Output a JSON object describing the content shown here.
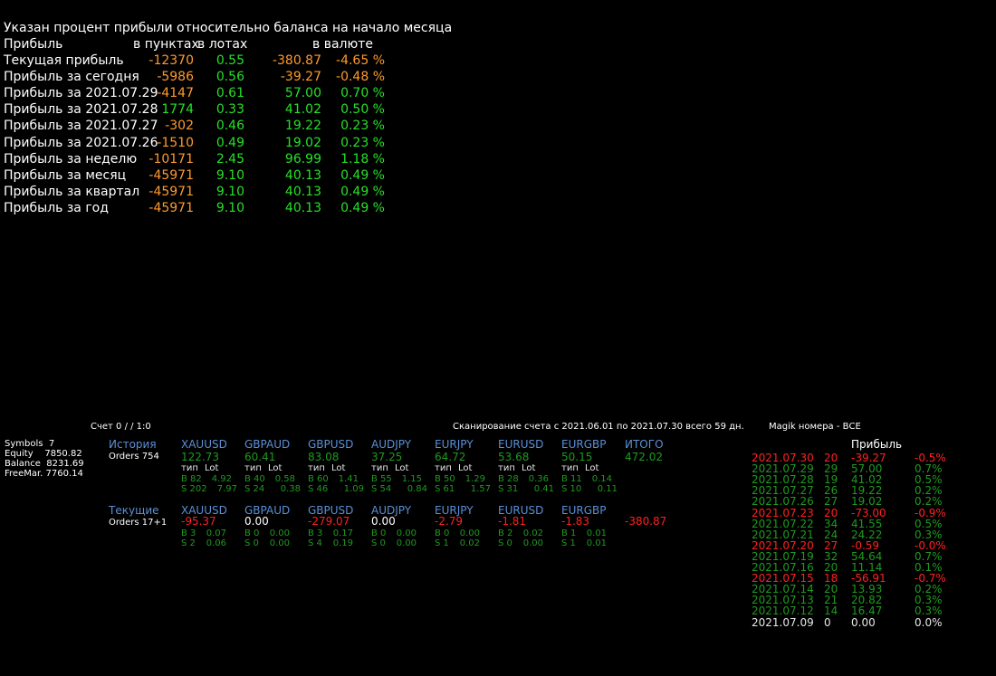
{
  "header": {
    "title": "Указан процент прибыли относительно баланса на начало месяца",
    "col_name": "Прибыль",
    "col_points": "в пунктах",
    "col_lots": "в лотах",
    "col_currency": "в валюте"
  },
  "profit_rows": [
    {
      "label": "Текущая прибыль",
      "points": "-12370",
      "lots": "0.55",
      "currency": "-380.87",
      "pct": "-4.65 %"
    },
    {
      "label": "Прибыль за сегодня",
      "points": "-5986",
      "lots": "0.56",
      "currency": "-39.27",
      "pct": "-0.48 %"
    },
    {
      "label": "Прибыль за 2021.07.29",
      "points": "-4147",
      "lots": "0.61",
      "currency": "57.00",
      "pct": "0.70 %"
    },
    {
      "label": "Прибыль за 2021.07.28",
      "points": "1774",
      "lots": "0.33",
      "currency": "41.02",
      "pct": "0.50 %"
    },
    {
      "label": "Прибыль за 2021.07.27",
      "points": "-302",
      "lots": "0.46",
      "currency": "19.22",
      "pct": "0.23 %"
    },
    {
      "label": "Прибыль за 2021.07.26",
      "points": "-1510",
      "lots": "0.49",
      "currency": "19.02",
      "pct": "0.23 %"
    },
    {
      "label": "Прибыль за неделю",
      "points": "-10171",
      "lots": "2.45",
      "currency": "96.99",
      "pct": "1.18 %"
    },
    {
      "label": "Прибыль за месяц",
      "points": "-45971",
      "lots": "9.10",
      "currency": "40.13",
      "pct": "0.49 %"
    },
    {
      "label": "Прибыль за квартал",
      "points": "-45971",
      "lots": "9.10",
      "currency": "40.13",
      "pct": "0.49 %"
    },
    {
      "label": "Прибыль за год",
      "points": "-45971",
      "lots": "9.10",
      "currency": "40.13",
      "pct": "0.49 %"
    }
  ],
  "colors": {
    "negative": "#ff9a2e",
    "positive": "#28e028",
    "loss": "#ff2020",
    "history_green": "#1f9a1f",
    "title_blue": "#5b8fd6"
  },
  "account": {
    "symbols_label": "Symbols",
    "symbols": "7",
    "equity_label": "Equity",
    "equity": "7850.82",
    "balance_label": "Balance",
    "balance": "8231.69",
    "freemar_label": "FreeMar.",
    "freemar": "7760.14",
    "account_info": "Счет 0 /  / 1:0",
    "scan_info": "Сканирование счета с 2021.06.01 по 2021.07.30 всего 59 дн.",
    "magik": "Magik номера - ВСЕ"
  },
  "history": {
    "title": "История",
    "orders": "Orders 754",
    "type_label": "тип",
    "lot_label": "Lot",
    "total_label": "ИТОГО",
    "total": "472.02",
    "symbols": [
      {
        "name": "XAUUSD",
        "value": "122.73",
        "b": "B 82",
        "b_lot": "4.92",
        "s": "S 202",
        "s_lot": "7.97"
      },
      {
        "name": "GBPAUD",
        "value": "60.41",
        "b": "B 40",
        "b_lot": "0.58",
        "s": "S 24",
        "s_lot": "0.38"
      },
      {
        "name": "GBPUSD",
        "value": "83.08",
        "b": "B 60",
        "b_lot": "1.41",
        "s": "S 46",
        "s_lot": "1.09"
      },
      {
        "name": "AUDJPY",
        "value": "37.25",
        "b": "B 55",
        "b_lot": "1.15",
        "s": "S 54",
        "s_lot": "0.84"
      },
      {
        "name": "EURJPY",
        "value": "64.72",
        "b": "B 50",
        "b_lot": "1.29",
        "s": "S 61",
        "s_lot": "1.57"
      },
      {
        "name": "EURUSD",
        "value": "53.68",
        "b": "B 28",
        "b_lot": "0.36",
        "s": "S 31",
        "s_lot": "0.41"
      },
      {
        "name": "EURGBP",
        "value": "50.15",
        "b": "B 11",
        "b_lot": "0.14",
        "s": "S 10",
        "s_lot": "0.11"
      }
    ]
  },
  "current": {
    "title": "Текущие",
    "orders": "Orders 17+1",
    "total": "-380.87",
    "symbols": [
      {
        "name": "XAUUSD",
        "value": "-95.37",
        "b": "B 3",
        "b_lot": "0.07",
        "s": "S 2",
        "s_lot": "0.06",
        "tone": "red"
      },
      {
        "name": "GBPAUD",
        "value": "0.00",
        "b": "B 0",
        "b_lot": "0.00",
        "s": "S 0",
        "s_lot": "0.00",
        "tone": "white"
      },
      {
        "name": "GBPUSD",
        "value": "-279.07",
        "b": "B 3",
        "b_lot": "0.17",
        "s": "S 4",
        "s_lot": "0.19",
        "tone": "red"
      },
      {
        "name": "AUDJPY",
        "value": "0.00",
        "b": "B 0",
        "b_lot": "0.00",
        "s": "S 0",
        "s_lot": "0.00",
        "tone": "white"
      },
      {
        "name": "EURJPY",
        "value": "-2.79",
        "b": "B 0",
        "b_lot": "0.00",
        "s": "S 1",
        "s_lot": "0.02",
        "tone": "red"
      },
      {
        "name": "EURUSD",
        "value": "-1.81",
        "b": "B 2",
        "b_lot": "0.02",
        "s": "S 0",
        "s_lot": "0.00",
        "tone": "red"
      },
      {
        "name": "EURGBP",
        "value": "-1.83",
        "b": "B 1",
        "b_lot": "0.01",
        "s": "S 1",
        "s_lot": "0.01",
        "tone": "red"
      }
    ]
  },
  "daily": {
    "title": "Прибыль",
    "rows": [
      {
        "date": "2021.07.30",
        "count": "20",
        "profit": "-39.27",
        "pct": "-0.5%",
        "tone": "red"
      },
      {
        "date": "2021.07.29",
        "count": "29",
        "profit": "57.00",
        "pct": "0.7%",
        "tone": "green"
      },
      {
        "date": "2021.07.28",
        "count": "19",
        "profit": "41.02",
        "pct": "0.5%",
        "tone": "green"
      },
      {
        "date": "2021.07.27",
        "count": "26",
        "profit": "19.22",
        "pct": "0.2%",
        "tone": "green"
      },
      {
        "date": "2021.07.26",
        "count": "27",
        "profit": "19.02",
        "pct": "0.2%",
        "tone": "green"
      },
      {
        "date": "2021.07.23",
        "count": "20",
        "profit": "-73.00",
        "pct": "-0.9%",
        "tone": "red"
      },
      {
        "date": "2021.07.22",
        "count": "34",
        "profit": "41.55",
        "pct": "0.5%",
        "tone": "green"
      },
      {
        "date": "2021.07.21",
        "count": "24",
        "profit": "24.22",
        "pct": "0.3%",
        "tone": "green"
      },
      {
        "date": "2021.07.20",
        "count": "27",
        "profit": "-0.59",
        "pct": "-0.0%",
        "tone": "red"
      },
      {
        "date": "2021.07.19",
        "count": "32",
        "profit": "54.64",
        "pct": "0.7%",
        "tone": "green"
      },
      {
        "date": "2021.07.16",
        "count": "20",
        "profit": "11.14",
        "pct": "0.1%",
        "tone": "green"
      },
      {
        "date": "2021.07.15",
        "count": "18",
        "profit": "-56.91",
        "pct": "-0.7%",
        "tone": "red"
      },
      {
        "date": "2021.07.14",
        "count": "20",
        "profit": "13.93",
        "pct": "0.2%",
        "tone": "green"
      },
      {
        "date": "2021.07.13",
        "count": "21",
        "profit": "20.82",
        "pct": "0.3%",
        "tone": "green"
      },
      {
        "date": "2021.07.12",
        "count": "14",
        "profit": "16.47",
        "pct": "0.3%",
        "tone": "green"
      },
      {
        "date": "2021.07.09",
        "count": "0",
        "profit": "0.00",
        "pct": "0.0%",
        "tone": "white"
      }
    ]
  }
}
